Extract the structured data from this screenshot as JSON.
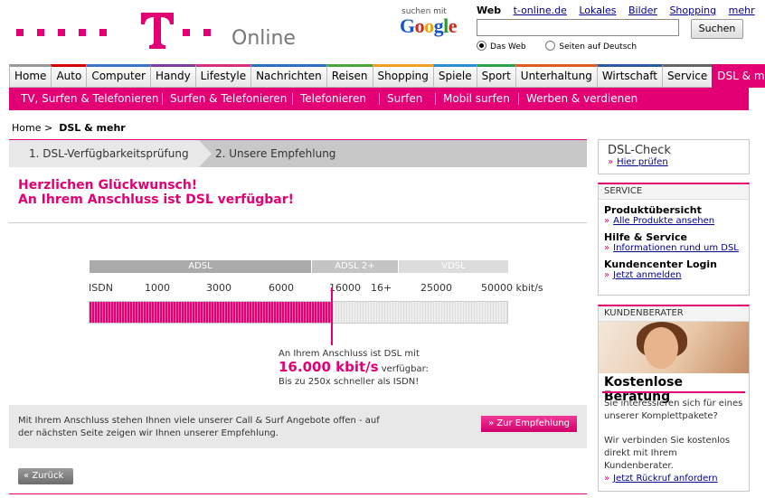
{
  "header": {
    "online_label": "Online",
    "suchen_mit": "suchen mit",
    "google_letters": [
      "G",
      "o",
      "o",
      "g",
      "l",
      "e"
    ],
    "search_tabs": {
      "current": "Web",
      "links": [
        "t-online.de",
        "Lokales",
        "Bilder",
        "Shopping",
        "mehr"
      ]
    },
    "search_input_value": "",
    "search_button": "Suchen",
    "radio_web": "Das Web",
    "radio_de": "Seiten auf Deutsch"
  },
  "main_nav": [
    "Home",
    "Auto",
    "Computer",
    "Handy",
    "Lifestyle",
    "Nachrichten",
    "Reisen",
    "Shopping",
    "Spiele",
    "Sport",
    "Unterhaltung",
    "Wirtschaft",
    "Service",
    "DSL & mehr"
  ],
  "main_nav_colors": [
    "#999999",
    "#d40000",
    "#3a75c4",
    "#7a3fa0",
    "#d4307f",
    "#2f6fbf",
    "#49a53c",
    "#f0a020",
    "#2c8fd0",
    "#2aa14a",
    "#e05b1f",
    "#2a5aa0",
    "#666666",
    "#e20074"
  ],
  "sub_nav": [
    "TV, Surfen & Telefonieren",
    "Surfen & Telefonieren",
    "Telefonieren",
    "Surfen",
    "Mobil surfen",
    "Werben & verdienen"
  ],
  "breadcrumb": {
    "home": "Home",
    "sep": ">",
    "current": "DSL & mehr"
  },
  "steps": {
    "step1": "1. DSL-Verfügbarkeitsprüfung",
    "step2": "2. Unsere Empfehlung"
  },
  "congrats": {
    "line1": "Herzlichen Glückwunsch!",
    "line2": "An Ihrem Anschluss ist DSL verfügbar!"
  },
  "speed_scale": {
    "bands": [
      "ADSL",
      "ADSL 2+",
      "VDSL"
    ],
    "ticks": [
      "ISDN",
      "1000",
      "3000",
      "6000",
      "16000",
      "16+",
      "25000",
      "50000 kbit/s"
    ],
    "available_fraction": 0.58
  },
  "result": {
    "line1": "An Ihrem Anschluss ist DSL mit",
    "speed": "16.000 kbit/s",
    "line2_suffix": " verfügbar:",
    "line3": "Bis zu 250x schneller als ISDN!"
  },
  "info": {
    "text": "Mit Ihrem Anschluss stehen Ihnen viele unserer Call & Surf Angebote offen - auf der nächsten Seite zeigen wir Ihnen unserer Empfehlung.",
    "button": "Zur Empfehlung"
  },
  "back_button": "Zurück",
  "sidebar": {
    "dsl_check": {
      "title": "DSL-Check",
      "link": "Hier prüfen"
    },
    "service": {
      "head": "SERVICE",
      "items": [
        {
          "title": "Produktübersicht",
          "link": "Alle Produkte ansehen"
        },
        {
          "title": "Hilfe & Service",
          "link": "Informationen rund um DSL"
        },
        {
          "title": "Kundencenter Login",
          "link": "Jetzt anmelden"
        }
      ]
    },
    "berater": {
      "head": "KUNDENBERATER",
      "title": "Kostenlose Beratung",
      "text1": "Sie interessieren sich für eines unserer Komplettpakete?",
      "text2": "Wir verbinden Sie kostenlos direkt mit Ihrem Kundenberater.",
      "link": "Jetzt Rückruf anfordern"
    }
  },
  "colors": {
    "brand": "#e20074",
    "link": "#00008b"
  }
}
